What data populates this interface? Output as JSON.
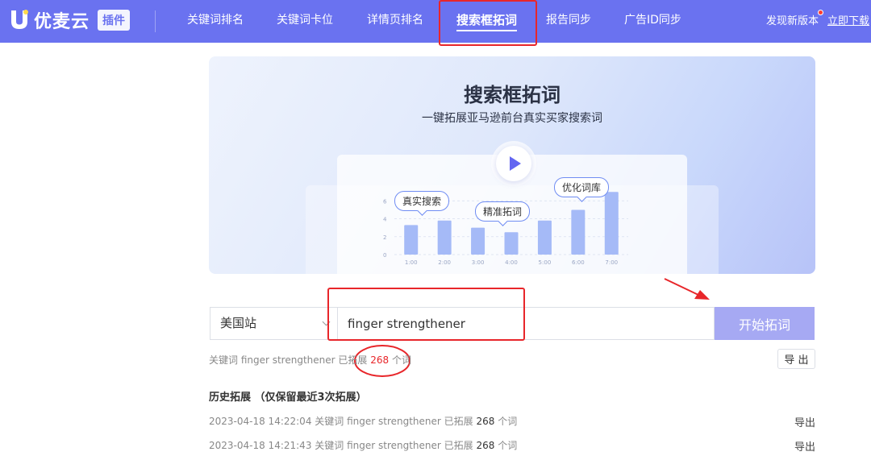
{
  "header": {
    "logo_text": "优麦云",
    "logo_badge": "插件",
    "nav": [
      {
        "label": "关键词排名"
      },
      {
        "label": "关键词卡位"
      },
      {
        "label": "详情页排名"
      },
      {
        "label": "搜索框拓词",
        "active": true
      },
      {
        "label": "报告同步"
      },
      {
        "label": "广告ID同步"
      }
    ],
    "new_version": "发现新版本",
    "download": "立即下载"
  },
  "banner": {
    "title": "搜索框拓词",
    "subtitle": "一键拓展亚马逊前台真实买家搜索词",
    "bubbles": [
      "真实搜索",
      "精准拓词",
      "优化词库"
    ]
  },
  "chart_data": {
    "type": "bar",
    "categories": [
      "1:00",
      "2:00",
      "3:00",
      "4:00",
      "5:00",
      "6:00",
      "7:00"
    ],
    "values": [
      3.3,
      3.8,
      3.0,
      2.5,
      3.8,
      5.0,
      7.0
    ],
    "yticks": [
      "0",
      "2",
      "4",
      "6"
    ],
    "ylim": [
      0,
      7.2
    ],
    "grid": true,
    "bar_color": "#a5baf7"
  },
  "search": {
    "site": "美国站",
    "keyword": "finger strengthener",
    "start_label": "开始拓词"
  },
  "result": {
    "prefix": "关键词 finger strengthener 已拓展 ",
    "count": "268",
    "suffix": " 个词",
    "export_label": "导 出"
  },
  "history": {
    "title": "历史拓展 （仅保留最近3次拓展）",
    "rows": [
      {
        "prefix": "2023-04-18 14:22:04 关键词 finger strengthener 已拓展 ",
        "count": "268",
        "suffix": " 个词",
        "export": "导出"
      },
      {
        "prefix": "2023-04-18 14:21:43 关键词 finger strengthener 已拓展 ",
        "count": "268",
        "suffix": " 个词",
        "export": "导出"
      }
    ]
  },
  "colors": {
    "nav_bg": "#6a72f0",
    "button_bg": "#a6a9f3",
    "highlight_red": "#e8262a"
  }
}
